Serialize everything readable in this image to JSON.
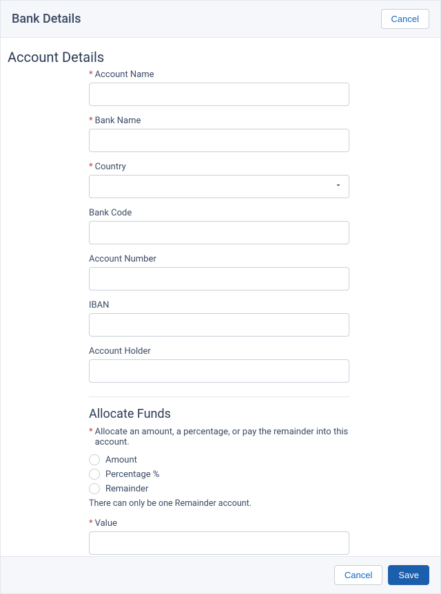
{
  "header": {
    "title": "Bank Details",
    "cancel": "Cancel"
  },
  "account_details": {
    "title": "Account Details",
    "fields": {
      "account_name": {
        "label": "Account Name",
        "value": "",
        "required": true
      },
      "bank_name": {
        "label": "Bank Name",
        "value": "",
        "required": true
      },
      "country": {
        "label": "Country",
        "value": "",
        "required": true
      },
      "bank_code": {
        "label": "Bank Code",
        "value": ""
      },
      "account_number": {
        "label": "Account Number",
        "value": ""
      },
      "iban": {
        "label": "IBAN",
        "value": ""
      },
      "account_holder": {
        "label": "Account Holder",
        "value": ""
      }
    }
  },
  "allocate_funds": {
    "title": "Allocate Funds",
    "hint": "Allocate an amount, a percentage, or pay the remainder into this account.",
    "options": {
      "amount": "Amount",
      "percentage": "Percentage %",
      "remainder": "Remainder"
    },
    "note": "There can only be one Remainder account.",
    "value_label": "Value",
    "value": ""
  },
  "footer": {
    "cancel": "Cancel",
    "save": "Save"
  },
  "required_marker": "*"
}
